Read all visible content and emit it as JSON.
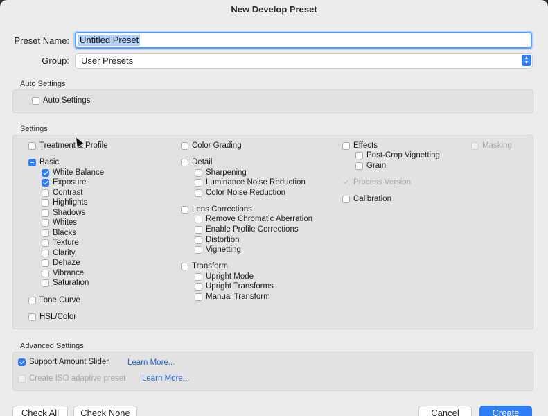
{
  "dialog": {
    "title": "New Develop Preset"
  },
  "preset_name": {
    "label": "Preset Name:",
    "value": "Untitled Preset"
  },
  "group": {
    "label": "Group:",
    "value": "User Presets"
  },
  "auto_settings": {
    "title": "Auto Settings",
    "checkbox": "Auto Settings"
  },
  "settings": {
    "title": "Settings",
    "col1": {
      "treatment": "Treatment & Profile",
      "basic": "Basic",
      "basic_items": [
        "White Balance",
        "Exposure",
        "Contrast",
        "Highlights",
        "Shadows",
        "Whites",
        "Blacks",
        "Texture",
        "Clarity",
        "Dehaze",
        "Vibrance",
        "Saturation"
      ],
      "tone_curve": "Tone Curve",
      "hsl": "HSL/Color"
    },
    "col2": {
      "color_grading": "Color Grading",
      "detail": "Detail",
      "detail_items": [
        "Sharpening",
        "Luminance Noise Reduction",
        "Color Noise Reduction"
      ],
      "lens": "Lens Corrections",
      "lens_items": [
        "Remove Chromatic Aberration",
        "Enable Profile Corrections",
        "Distortion",
        "Vignetting"
      ],
      "transform": "Transform",
      "transform_items": [
        "Upright Mode",
        "Upright Transforms",
        "Manual Transform"
      ]
    },
    "col3": {
      "effects": "Effects",
      "effects_items": [
        "Post-Crop Vignetting",
        "Grain"
      ],
      "process_version": "Process Version",
      "calibration": "Calibration"
    },
    "col4": {
      "masking": "Masking"
    }
  },
  "advanced": {
    "title": "Advanced Settings",
    "support_amount": "Support Amount Slider",
    "iso_adaptive": "Create ISO adaptive preset",
    "learn_more_1": "Learn More...",
    "learn_more_2": "Learn More..."
  },
  "buttons": {
    "check_all": "Check All",
    "check_none": "Check None",
    "cancel": "Cancel",
    "create": "Create"
  },
  "colors": {
    "accent": "#2f7df6",
    "link": "#2363c9"
  }
}
